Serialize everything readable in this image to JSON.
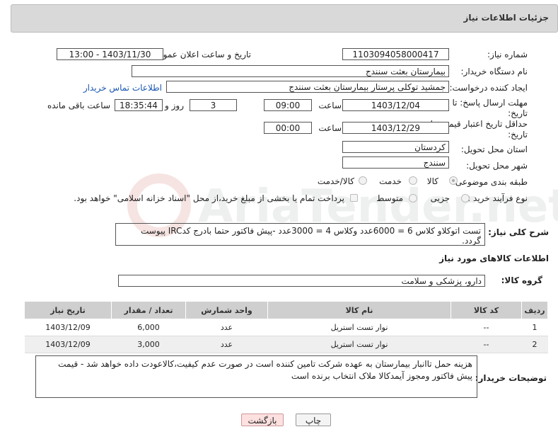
{
  "header": {
    "title": "جزئیات اطلاعات نیاز"
  },
  "fields": {
    "need_number_label": "شماره نیاز:",
    "need_number": "1103094058000417",
    "announce_label": "تاریخ و ساعت اعلان عمومی:",
    "announce_value": "1403/11/30 - 13:00",
    "buyer_org_label": "نام دستگاه خریدار:",
    "buyer_org": "بیمارستان بعثت سنندج",
    "requester_label": "ایجاد کننده درخواست:",
    "requester": "جمشید  توکلی پرستار بیمارستان بعثت سنندج",
    "buyer_contact_link": "اطلاعات تماس خریدار",
    "deadline_label": "مهلت ارسال پاسخ: تا",
    "deadline_label2": "تاریخ:",
    "deadline_date": "1403/12/04",
    "time_label": "ساعت",
    "deadline_time": "09:00",
    "days_value": "3",
    "days_label": "روز و",
    "remaining_time": "18:35:44",
    "remaining_label": "ساعت باقی مانده",
    "min_price_label": "حداقل تاریخ اعتبار قیمت: تا",
    "min_price_label2": "تاریخ:",
    "min_price_date": "1403/12/29",
    "min_price_time": "00:00",
    "province_label": "استان محل تحویل:",
    "province": "کردستان",
    "city_label": "شهر محل تحویل:",
    "city": "سنندج",
    "category_label": "طبقه بندی موضوعی:",
    "category_opt1": "کالا",
    "category_opt2": "خدمت",
    "category_opt3": "کالا/خدمت",
    "purchase_label": "نوع فرآیند خرید :",
    "purchase_opt1": "جزیی",
    "purchase_opt2": "متوسط",
    "purchase_note": "پرداخت تمام یا بخشی از مبلغ خرید،از محل \"اسناد خزانه اسلامی\" خواهد بود."
  },
  "description": {
    "label": "شرح کلی نیاز:",
    "text": "تست اتوکلاو کلاس 6 = 6000عدد وکلاس 4 = 3000عدد -پیش فاکتور حتما بادرج کدIRC پیوست گردد."
  },
  "goods_section": {
    "title": "اطلاعات کالاهای مورد نیاز",
    "group_label": "گروه کالا:",
    "group_value": "دارو، پزشکی و سلامت"
  },
  "table": {
    "headers": [
      "ردیف",
      "کد کالا",
      "نام کالا",
      "واحد شمارش",
      "تعداد / مقدار",
      "تاریخ نیاز"
    ],
    "rows": [
      [
        "1",
        "--",
        "نوار تست استریل",
        "عدد",
        "6,000",
        "1403/12/09"
      ],
      [
        "2",
        "--",
        "نوار تست استریل",
        "عدد",
        "3,000",
        "1403/12/09"
      ]
    ]
  },
  "buyer_notes": {
    "label": "توضیحات خریدار:",
    "text": "هزینه حمل تاانبار بیمارستان به عهده شرکت تامین کننده است در صورت عدم کیفیت،کالاعودت داده خواهد شد - قیمت پیش فاکتور ومجوز آیمدکالا ملاک انتخاب برنده است"
  },
  "buttons": {
    "print": "چاپ",
    "back": "بازگشت"
  },
  "colors": {
    "link": "#1a56b0",
    "header_bg": "#d9d9d9",
    "back_button_bg": "#fde0e0"
  }
}
